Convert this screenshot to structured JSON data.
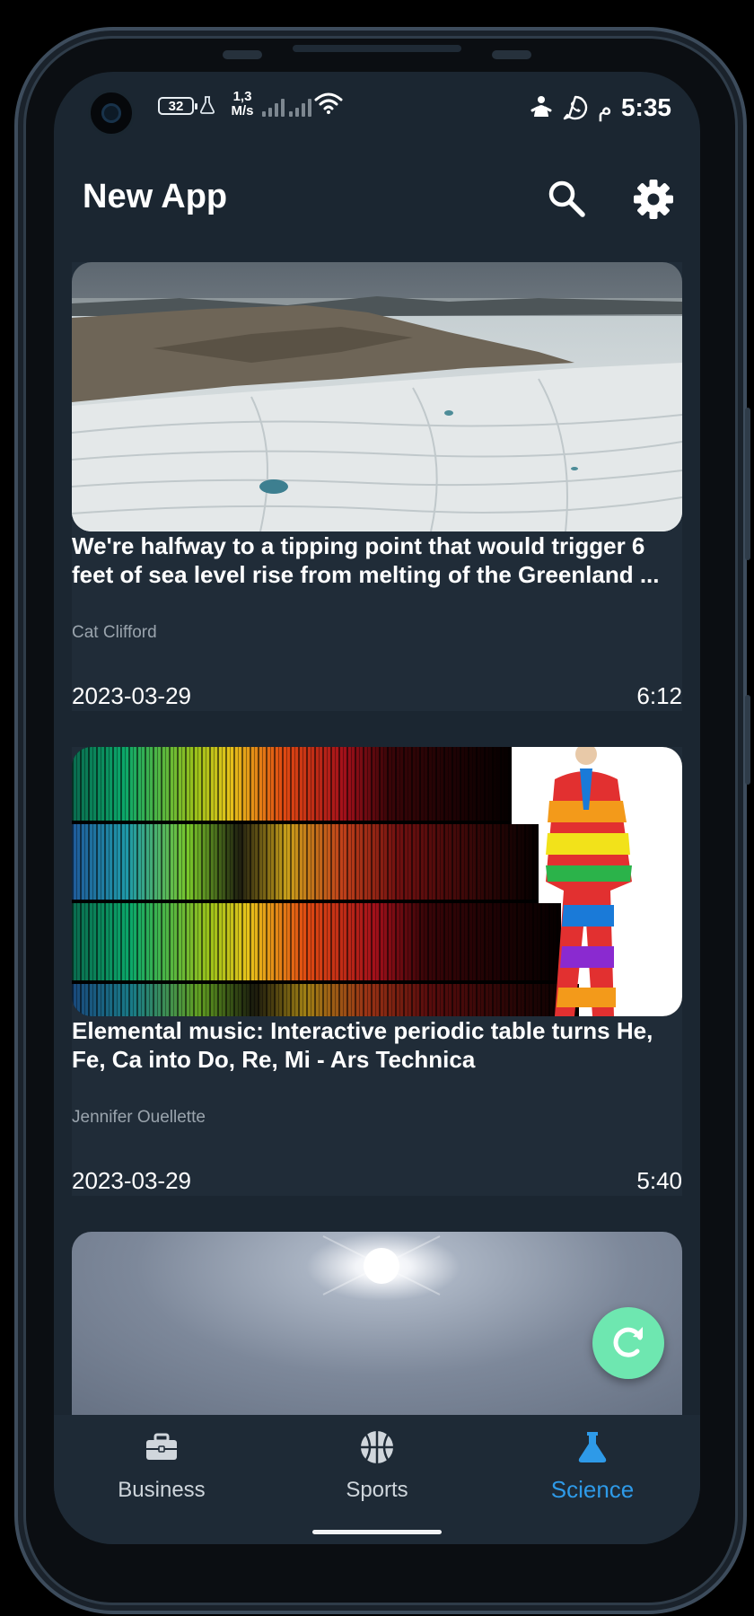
{
  "status_bar": {
    "battery": "32",
    "speed_value": "1,3",
    "speed_unit": "M/s",
    "arabic_indicator": "م",
    "time": "5:35"
  },
  "app_bar": {
    "title": "New App",
    "search_icon": "search-icon",
    "settings_icon": "gear-icon"
  },
  "articles": [
    {
      "image": "Aerial view of the Greenland ice sheet",
      "title": "We're halfway to a tipping point that would trigger 6 feet of sea level rise from melting of the Greenland ...",
      "author": "Cat Clifford",
      "date": "2023-03-29",
      "time": "6:12"
    },
    {
      "image": "Element emission spectra with man in rainbow suit",
      "title": "Elemental music: Interactive periodic table turns He, Fe, Ca into Do, Re, Mi - Ars Technica",
      "author": "Jennifer Ouellette",
      "date": "2023-03-29",
      "time": "5:40"
    },
    {
      "image": "Sun in a hazy sky"
    }
  ],
  "fab": {
    "icon": "refresh-icon"
  },
  "bottom_nav": {
    "items": [
      {
        "label": "Business",
        "icon": "briefcase-icon",
        "active": false
      },
      {
        "label": "Sports",
        "icon": "basketball-icon",
        "active": false
      },
      {
        "label": "Science",
        "icon": "flask-icon",
        "active": true
      }
    ]
  },
  "colors": {
    "background": "#1b2631",
    "card": "#202c38",
    "accent": "#2e9ae8",
    "fab": "#6ee7b0"
  }
}
